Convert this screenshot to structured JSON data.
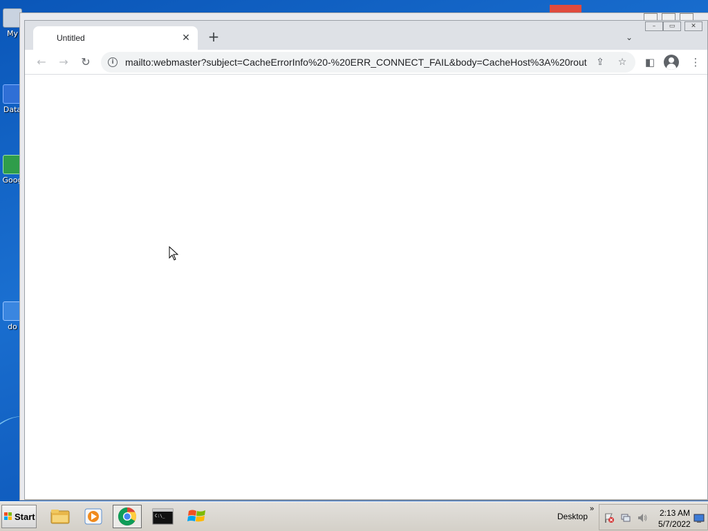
{
  "desktop": {
    "icons": [
      {
        "label": "My"
      },
      {
        "label": "Data"
      },
      {
        "label": "Goog"
      },
      {
        "label": "do"
      }
    ]
  },
  "browser": {
    "tab": {
      "title": "Untitled",
      "close_glyph": "✕"
    },
    "new_tab_glyph": "+",
    "tab_search_glyph": "⌄",
    "window_controls": {
      "minimize": "–",
      "maximize": "▭",
      "close": "✕"
    },
    "nav": {
      "back": "←",
      "forward": "→",
      "reload": "↻"
    },
    "omnibox": {
      "info_icon": "i",
      "url": "mailto:webmaster?subject=CacheErrorInfo%20-%20ERR_CONNECT_FAIL&body=CacheHost%3A%20rout...",
      "share_icon": "⇪",
      "bookmark_icon": "☆"
    },
    "side_panel_icon": "◧",
    "menu_icon": "⋮"
  },
  "taskbar": {
    "start_label": "Start",
    "apps": [
      {
        "name": "file-explorer",
        "active": false
      },
      {
        "name": "media-player",
        "active": false
      },
      {
        "name": "chrome",
        "active": true
      },
      {
        "name": "command-prompt",
        "active": false
      },
      {
        "name": "windows-logo",
        "active": false
      }
    ],
    "desktop_label": "Desktop",
    "overflow_glyph": "»",
    "clock": {
      "time": "2:13 AM",
      "date": "5/7/2022"
    }
  },
  "colors": {
    "desktop_bg": "#1565c0",
    "tabstrip_bg": "#dee1e6",
    "omnibox_bg": "#f1f3f4",
    "taskbar_bg": "#d4d0c8"
  }
}
